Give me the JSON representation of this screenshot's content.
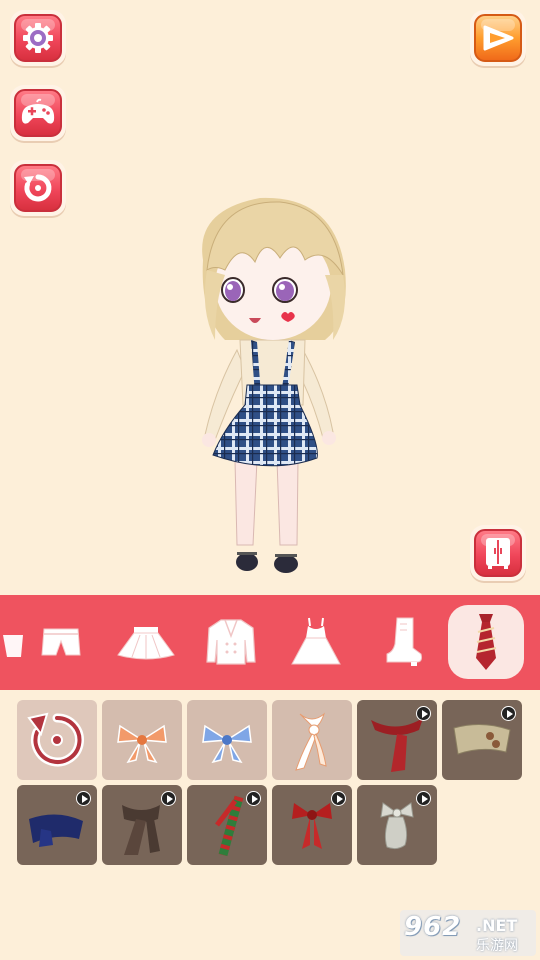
{
  "toolbar": {
    "left_buttons": [
      {
        "icon": "gear-icon"
      },
      {
        "icon": "gamepad-icon"
      },
      {
        "icon": "reset-icon"
      }
    ],
    "right_button": {
      "icon": "play-video-icon"
    },
    "wardrobe_button": {
      "icon": "wardrobe-icon"
    }
  },
  "categories": [
    {
      "icon": "top-partial-icon",
      "active": false
    },
    {
      "icon": "shorts-icon",
      "active": false
    },
    {
      "icon": "skirt-icon",
      "active": false
    },
    {
      "icon": "jacket-icon",
      "active": false
    },
    {
      "icon": "dress-icon",
      "active": false
    },
    {
      "icon": "boot-icon",
      "active": false
    },
    {
      "icon": "necktie-icon",
      "active": true
    }
  ],
  "items": [
    {
      "icon": "remove-item-icon",
      "locked": false
    },
    {
      "icon": "orange-striped-bow-icon",
      "locked": false
    },
    {
      "icon": "blue-striped-bow-icon",
      "locked": false
    },
    {
      "icon": "orange-scarf-knot-icon",
      "locked": false
    },
    {
      "icon": "red-scarf-icon",
      "locked": true
    },
    {
      "icon": "beige-button-scarf-icon",
      "locked": true
    },
    {
      "icon": "navy-knit-scarf-icon",
      "locked": true
    },
    {
      "icon": "brown-plaid-scarf-icon",
      "locked": true
    },
    {
      "icon": "christmas-striped-scarf-icon",
      "locked": true
    },
    {
      "icon": "red-ribbon-bow-icon",
      "locked": true
    },
    {
      "icon": "grey-lace-bow-icon",
      "locked": true
    }
  ],
  "colors": {
    "background": "#fdefd9",
    "category_bar": "#ef535f",
    "button_red": "#f0465a",
    "button_orange": "#ff9d2e",
    "tile": "#d4bcae",
    "tile_dark": "#786558"
  },
  "watermark": {
    "number": "962",
    "domain": ".NET",
    "chinese": "乐游网"
  }
}
